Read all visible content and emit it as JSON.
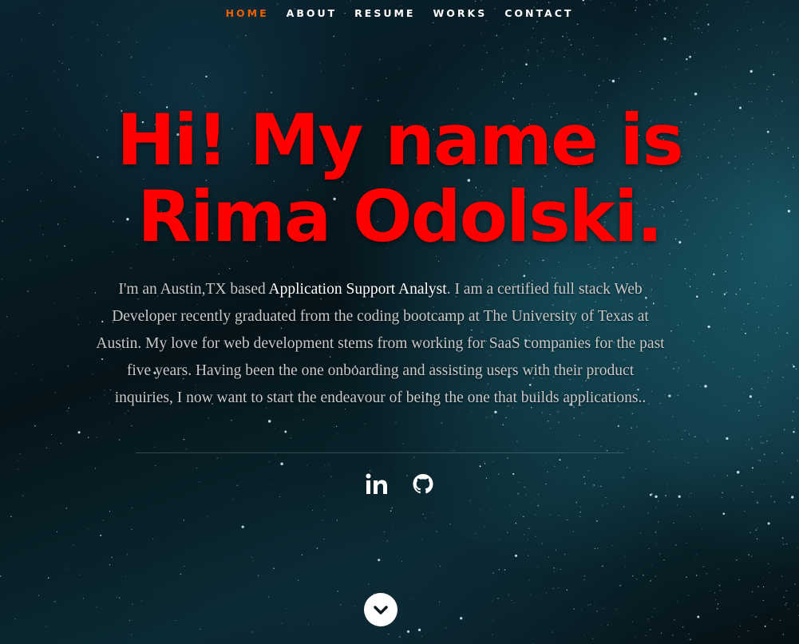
{
  "nav": {
    "items": [
      {
        "label": "HOME",
        "active": true
      },
      {
        "label": "ABOUT",
        "active": false
      },
      {
        "label": "RESUME",
        "active": false
      },
      {
        "label": "WORKS",
        "active": false
      },
      {
        "label": "CONTACT",
        "active": false
      }
    ]
  },
  "hero": {
    "headline_line1": "Hi! My name is",
    "headline_line2": "Rima Odolski.",
    "intro_prefix": "I'm an Austin,TX based ",
    "intro_role": "Application Support Analyst",
    "intro_suffix": ". I am a certified full stack Web Developer recently graduated from the coding bootcamp at The University of Texas at Austin. My love for web development stems from working for SaaS companies for the past five years. Having been the one onboarding and assisting users with their product inquiries, I now want to start the endeavour of being the one that builds applications.."
  },
  "social": [
    {
      "icon": "linkedin-icon"
    },
    {
      "icon": "github-icon"
    }
  ],
  "scroll": {
    "icon": "chevron-down-icon"
  },
  "colors": {
    "accent_nav": "#f06000",
    "headline": "#ff0000",
    "body_text": "#c9c9c9"
  }
}
